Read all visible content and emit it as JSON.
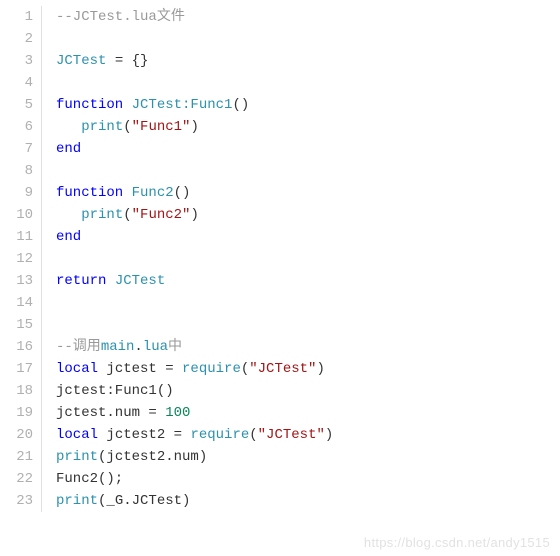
{
  "watermark": "https://blog.csdn.net/andy1515",
  "line_count": 23,
  "lines": {
    "l1": {
      "c1": "--JCTest.lua文件"
    },
    "l2": {},
    "l3": {
      "c1": "JCTest",
      "c2": " = {}"
    },
    "l4": {},
    "l5": {
      "c1": "function",
      "c2": " ",
      "c3": "JCTest:Func1",
      "c4": "()"
    },
    "l6": {
      "indent": "   ",
      "c1": "print",
      "c2": "(",
      "c3": "\"Func1\"",
      "c4": ")"
    },
    "l7": {
      "c1": "end"
    },
    "l8": {},
    "l9": {
      "c1": "function",
      "c2": " ",
      "c3": "Func2",
      "c4": "()"
    },
    "l10": {
      "indent": "   ",
      "c1": "print",
      "c2": "(",
      "c3": "\"Func2\"",
      "c4": ")"
    },
    "l11": {
      "c1": "end"
    },
    "l12": {},
    "l13": {
      "c1": "return",
      "c2": " ",
      "c3": "JCTest"
    },
    "l14": {},
    "l15": {},
    "l16": {
      "c1": "--调用",
      "c2": "main",
      "c3": ".",
      "c4": "lua",
      "c5": "中"
    },
    "l17": {
      "c1": "local",
      "c2": " jctest = ",
      "c3": "require",
      "c4": "(",
      "c5": "\"JCTest\"",
      "c6": ")"
    },
    "l18": {
      "c1": "jctest:Func1()"
    },
    "l19": {
      "c1": "jctest.num = ",
      "c2": "100"
    },
    "l20": {
      "c1": "local",
      "c2": " jctest2 = ",
      "c3": "require",
      "c4": "(",
      "c5": "\"JCTest\"",
      "c6": ")"
    },
    "l21": {
      "c1": "print",
      "c2": "(jctest2.num)"
    },
    "l22": {
      "c1": "Func2();"
    },
    "l23": {
      "c1": "print",
      "c2": "(_G.JCTest)"
    }
  }
}
